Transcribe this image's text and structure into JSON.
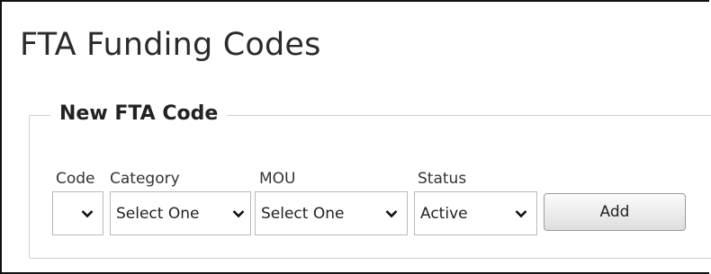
{
  "page": {
    "title": "FTA Funding Codes"
  },
  "form": {
    "legend": "New FTA Code",
    "fields": {
      "code": {
        "label": "Code",
        "value": ""
      },
      "category": {
        "label": "Category",
        "value": "Select One"
      },
      "mou": {
        "label": "MOU",
        "value": "Select One"
      },
      "status": {
        "label": "Status",
        "value": "Active"
      }
    },
    "add_label": "Add"
  },
  "icons": {
    "dropdown": "chevron-down-icon"
  }
}
